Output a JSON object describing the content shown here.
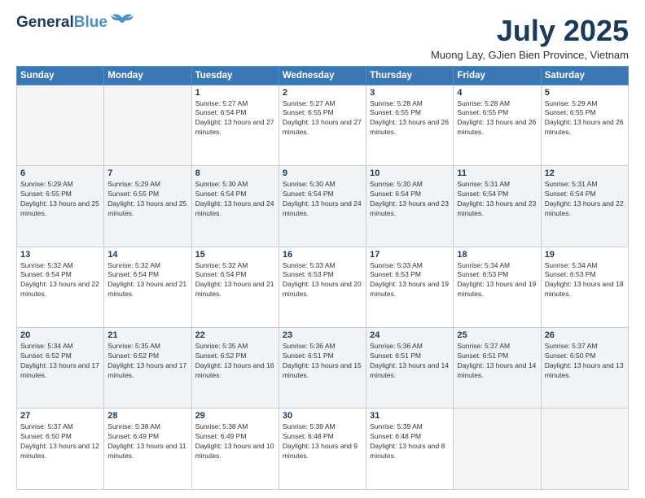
{
  "header": {
    "logo_line1": "General",
    "logo_line2": "Blue",
    "month_year": "July 2025",
    "location": "Muong Lay, GJien Bien Province, Vietnam"
  },
  "weekdays": [
    "Sunday",
    "Monday",
    "Tuesday",
    "Wednesday",
    "Thursday",
    "Friday",
    "Saturday"
  ],
  "weeks": [
    [
      {
        "day": "",
        "sunrise": "",
        "sunset": "",
        "daylight": ""
      },
      {
        "day": "",
        "sunrise": "",
        "sunset": "",
        "daylight": ""
      },
      {
        "day": "1",
        "sunrise": "Sunrise: 5:27 AM",
        "sunset": "Sunset: 6:54 PM",
        "daylight": "Daylight: 13 hours and 27 minutes."
      },
      {
        "day": "2",
        "sunrise": "Sunrise: 5:27 AM",
        "sunset": "Sunset: 6:55 PM",
        "daylight": "Daylight: 13 hours and 27 minutes."
      },
      {
        "day": "3",
        "sunrise": "Sunrise: 5:28 AM",
        "sunset": "Sunset: 6:55 PM",
        "daylight": "Daylight: 13 hours and 26 minutes."
      },
      {
        "day": "4",
        "sunrise": "Sunrise: 5:28 AM",
        "sunset": "Sunset: 6:55 PM",
        "daylight": "Daylight: 13 hours and 26 minutes."
      },
      {
        "day": "5",
        "sunrise": "Sunrise: 5:29 AM",
        "sunset": "Sunset: 6:55 PM",
        "daylight": "Daylight: 13 hours and 26 minutes."
      }
    ],
    [
      {
        "day": "6",
        "sunrise": "Sunrise: 5:29 AM",
        "sunset": "Sunset: 6:55 PM",
        "daylight": "Daylight: 13 hours and 25 minutes."
      },
      {
        "day": "7",
        "sunrise": "Sunrise: 5:29 AM",
        "sunset": "Sunset: 6:55 PM",
        "daylight": "Daylight: 13 hours and 25 minutes."
      },
      {
        "day": "8",
        "sunrise": "Sunrise: 5:30 AM",
        "sunset": "Sunset: 6:54 PM",
        "daylight": "Daylight: 13 hours and 24 minutes."
      },
      {
        "day": "9",
        "sunrise": "Sunrise: 5:30 AM",
        "sunset": "Sunset: 6:54 PM",
        "daylight": "Daylight: 13 hours and 24 minutes."
      },
      {
        "day": "10",
        "sunrise": "Sunrise: 5:30 AM",
        "sunset": "Sunset: 6:54 PM",
        "daylight": "Daylight: 13 hours and 23 minutes."
      },
      {
        "day": "11",
        "sunrise": "Sunrise: 5:31 AM",
        "sunset": "Sunset: 6:54 PM",
        "daylight": "Daylight: 13 hours and 23 minutes."
      },
      {
        "day": "12",
        "sunrise": "Sunrise: 5:31 AM",
        "sunset": "Sunset: 6:54 PM",
        "daylight": "Daylight: 13 hours and 22 minutes."
      }
    ],
    [
      {
        "day": "13",
        "sunrise": "Sunrise: 5:32 AM",
        "sunset": "Sunset: 6:54 PM",
        "daylight": "Daylight: 13 hours and 22 minutes."
      },
      {
        "day": "14",
        "sunrise": "Sunrise: 5:32 AM",
        "sunset": "Sunset: 6:54 PM",
        "daylight": "Daylight: 13 hours and 21 minutes."
      },
      {
        "day": "15",
        "sunrise": "Sunrise: 5:32 AM",
        "sunset": "Sunset: 6:54 PM",
        "daylight": "Daylight: 13 hours and 21 minutes."
      },
      {
        "day": "16",
        "sunrise": "Sunrise: 5:33 AM",
        "sunset": "Sunset: 6:53 PM",
        "daylight": "Daylight: 13 hours and 20 minutes."
      },
      {
        "day": "17",
        "sunrise": "Sunrise: 5:33 AM",
        "sunset": "Sunset: 6:53 PM",
        "daylight": "Daylight: 13 hours and 19 minutes."
      },
      {
        "day": "18",
        "sunrise": "Sunrise: 5:34 AM",
        "sunset": "Sunset: 6:53 PM",
        "daylight": "Daylight: 13 hours and 19 minutes."
      },
      {
        "day": "19",
        "sunrise": "Sunrise: 5:34 AM",
        "sunset": "Sunset: 6:53 PM",
        "daylight": "Daylight: 13 hours and 18 minutes."
      }
    ],
    [
      {
        "day": "20",
        "sunrise": "Sunrise: 5:34 AM",
        "sunset": "Sunset: 6:52 PM",
        "daylight": "Daylight: 13 hours and 17 minutes."
      },
      {
        "day": "21",
        "sunrise": "Sunrise: 5:35 AM",
        "sunset": "Sunset: 6:52 PM",
        "daylight": "Daylight: 13 hours and 17 minutes."
      },
      {
        "day": "22",
        "sunrise": "Sunrise: 5:35 AM",
        "sunset": "Sunset: 6:52 PM",
        "daylight": "Daylight: 13 hours and 16 minutes."
      },
      {
        "day": "23",
        "sunrise": "Sunrise: 5:36 AM",
        "sunset": "Sunset: 6:51 PM",
        "daylight": "Daylight: 13 hours and 15 minutes."
      },
      {
        "day": "24",
        "sunrise": "Sunrise: 5:36 AM",
        "sunset": "Sunset: 6:51 PM",
        "daylight": "Daylight: 13 hours and 14 minutes."
      },
      {
        "day": "25",
        "sunrise": "Sunrise: 5:37 AM",
        "sunset": "Sunset: 6:51 PM",
        "daylight": "Daylight: 13 hours and 14 minutes."
      },
      {
        "day": "26",
        "sunrise": "Sunrise: 5:37 AM",
        "sunset": "Sunset: 6:50 PM",
        "daylight": "Daylight: 13 hours and 13 minutes."
      }
    ],
    [
      {
        "day": "27",
        "sunrise": "Sunrise: 5:37 AM",
        "sunset": "Sunset: 6:50 PM",
        "daylight": "Daylight: 13 hours and 12 minutes."
      },
      {
        "day": "28",
        "sunrise": "Sunrise: 5:38 AM",
        "sunset": "Sunset: 6:49 PM",
        "daylight": "Daylight: 13 hours and 11 minutes."
      },
      {
        "day": "29",
        "sunrise": "Sunrise: 5:38 AM",
        "sunset": "Sunset: 6:49 PM",
        "daylight": "Daylight: 13 hours and 10 minutes."
      },
      {
        "day": "30",
        "sunrise": "Sunrise: 5:39 AM",
        "sunset": "Sunset: 6:48 PM",
        "daylight": "Daylight: 13 hours and 9 minutes."
      },
      {
        "day": "31",
        "sunrise": "Sunrise: 5:39 AM",
        "sunset": "Sunset: 6:48 PM",
        "daylight": "Daylight: 13 hours and 8 minutes."
      },
      {
        "day": "",
        "sunrise": "",
        "sunset": "",
        "daylight": ""
      },
      {
        "day": "",
        "sunrise": "",
        "sunset": "",
        "daylight": ""
      }
    ]
  ]
}
